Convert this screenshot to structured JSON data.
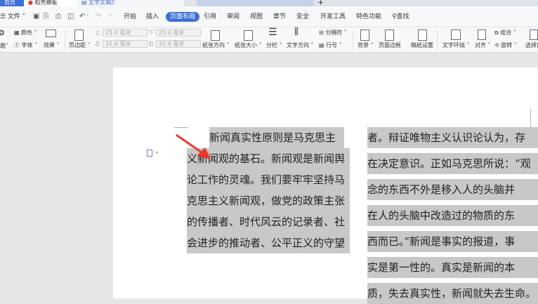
{
  "window": {
    "tabs": [
      {
        "label": "首页"
      },
      {
        "label": "稻壳模板"
      },
      {
        "label": "文字文稿2"
      }
    ],
    "new_tab": "+"
  },
  "menubar": {
    "file": "☰ 文件 ˅",
    "items": [
      "开始",
      "插入",
      "页面布局",
      "引用",
      "审阅",
      "视图",
      "章节",
      "安全",
      "开发工具",
      "特色功能"
    ],
    "active": "页面布局",
    "search": "查找"
  },
  "toolbar": {
    "theme_colors": "颜色",
    "theme_fonts": "字体",
    "theme_effects": "效果",
    "margins": "页边距",
    "top_label": "上",
    "bottom_label": "下",
    "left_label": "左",
    "right_label": "右",
    "top_value": "25.4 毫米",
    "bottom_value": "25.4 毫米",
    "left_value": "31.8 毫米",
    "right_value": "31.8 毫米",
    "orientation": "纸张方向",
    "size": "纸张大小",
    "columns": "分栏",
    "text_direction": "文字方向",
    "breaks": "分隔符",
    "line_numbers": "行号",
    "background": "背景",
    "page_border": "页面边框",
    "paper_setup": "稿纸设置",
    "wrap": "文字环绕",
    "align": "对齐",
    "group": "组合",
    "rotate": "旋转",
    "select": "选择窗"
  },
  "document": {
    "col1": [
      "新闻真实性原则是马克思主",
      "义新闻观的基石。新闻观是新闻舆",
      "论工作的灵魂。我们要牢牢坚持马",
      "克思主义新闻观，做党的政策主张",
      "的传播者、时代风云的记录者、社",
      "会进步的推动者、公平正义的守望"
    ],
    "col2": [
      "者。辩证唯物主义认识论认为，存",
      "在决定意识。正如马克思所说：“观",
      "念的东西不外是移入人的头脑并",
      "在人的头脑中改造过的物质的东",
      "西而已。”新闻是事实的报道，事",
      "实是第一性的。真实是新闻的本",
      "质，失去真实性，新闻就失去生命。"
    ]
  },
  "colors": {
    "accent": "#3d6fd8",
    "highlight": "#c8c8c8",
    "arrow": "#e8382c"
  }
}
